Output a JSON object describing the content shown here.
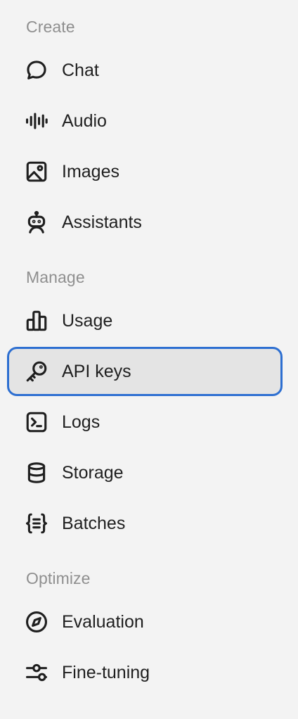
{
  "sections": [
    {
      "label": "Create",
      "items": [
        {
          "label": "Chat",
          "icon": "chat-bubble-icon"
        },
        {
          "label": "Audio",
          "icon": "audio-waveform-icon"
        },
        {
          "label": "Images",
          "icon": "image-icon"
        },
        {
          "label": "Assistants",
          "icon": "robot-icon"
        }
      ]
    },
    {
      "label": "Manage",
      "items": [
        {
          "label": "Usage",
          "icon": "bar-chart-icon"
        },
        {
          "label": "API keys",
          "icon": "key-icon",
          "active": true
        },
        {
          "label": "Logs",
          "icon": "terminal-icon"
        },
        {
          "label": "Storage",
          "icon": "database-icon"
        },
        {
          "label": "Batches",
          "icon": "curly-braces-list-icon"
        }
      ]
    },
    {
      "label": "Optimize",
      "items": [
        {
          "label": "Evaluation",
          "icon": "compass-icon"
        },
        {
          "label": "Fine-tuning",
          "icon": "sliders-icon"
        }
      ]
    }
  ],
  "colors": {
    "background": "#f3f3f3",
    "active_background": "#e4e4e4",
    "active_border": "#2d6fd1",
    "section_label": "#8f8f8f",
    "text": "#1f1f1f"
  }
}
